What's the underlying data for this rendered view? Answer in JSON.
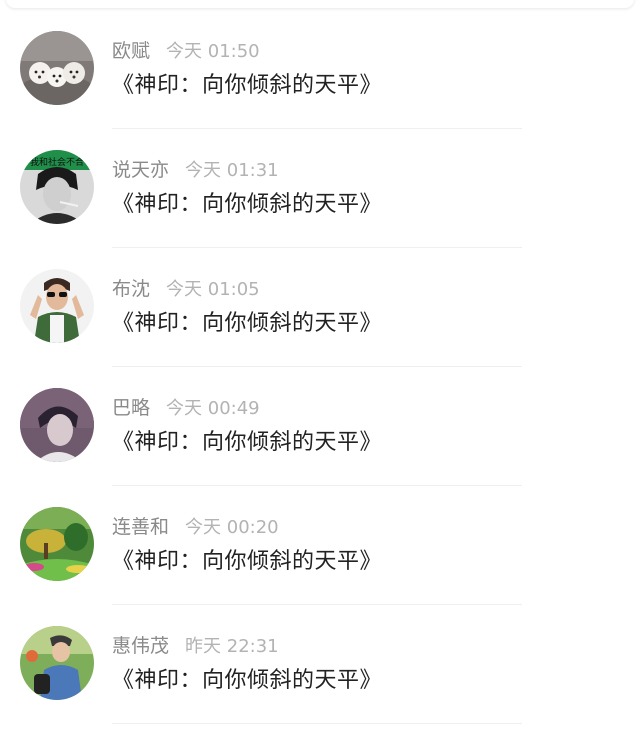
{
  "comments": [
    {
      "name": "欧赋",
      "time": "今天 01:50",
      "text": "《神印：向你倾斜的天平》",
      "avatar_icon": "puppies-avatar-icon"
    },
    {
      "name": "说天亦",
      "time": "今天 01:31",
      "text": "《神印：向你倾斜的天平》",
      "avatar_icon": "smoking-man-avatar-icon",
      "avatar_caption": "我和社会不合"
    },
    {
      "name": "布沈",
      "time": "今天 01:05",
      "text": "《神印：向你倾斜的天平》",
      "avatar_icon": "sunglasses-man-avatar-icon"
    },
    {
      "name": "巴略",
      "time": "今天 00:49",
      "text": "《神印：向你倾斜的天平》",
      "avatar_icon": "portrait-avatar-icon"
    },
    {
      "name": "连善和",
      "time": "今天 00:20",
      "text": "《神印：向你倾斜的天平》",
      "avatar_icon": "garden-avatar-icon"
    },
    {
      "name": "惠伟茂",
      "time": "昨天 22:31",
      "text": "《神印：向你倾斜的天平》",
      "avatar_icon": "woman-outdoors-avatar-icon"
    }
  ],
  "colors": {
    "name": "#8a8a8a",
    "time": "#b3b3b3",
    "text": "#222222",
    "divider": "#efefef"
  }
}
